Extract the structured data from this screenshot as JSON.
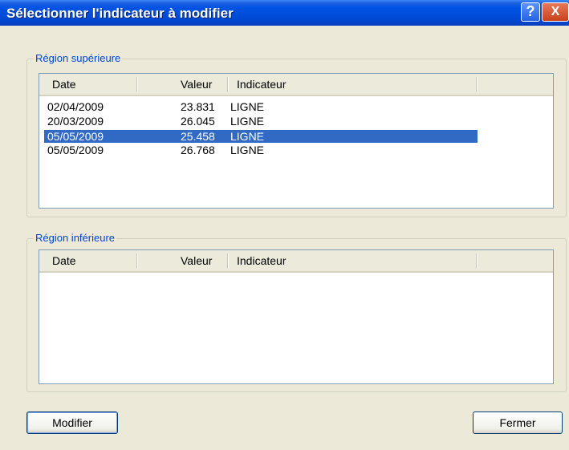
{
  "window": {
    "title": "Sélectionner l'indicateur à modifier",
    "help_glyph": "?",
    "close_glyph": "X"
  },
  "upper_region": {
    "label": "Région supérieure",
    "columns": [
      "Date",
      "Valeur",
      "Indicateur"
    ],
    "rows": [
      {
        "date": "02/04/2009",
        "value": "23.831",
        "indicator": "LIGNE",
        "selected": false
      },
      {
        "date": "20/03/2009",
        "value": "26.045",
        "indicator": "LIGNE",
        "selected": false
      },
      {
        "date": "05/05/2009",
        "value": "25.458",
        "indicator": "LIGNE",
        "selected": true
      },
      {
        "date": "05/05/2009",
        "value": "26.768",
        "indicator": "LIGNE",
        "selected": false
      }
    ]
  },
  "lower_region": {
    "label": "Région inférieure",
    "columns": [
      "Date",
      "Valeur",
      "Indicateur"
    ],
    "rows": []
  },
  "buttons": {
    "modify": "Modifier",
    "close": "Fermer"
  },
  "colors": {
    "selection": "#316ac5",
    "legend_text": "#0046d5",
    "title_bar": "#0054e3"
  }
}
